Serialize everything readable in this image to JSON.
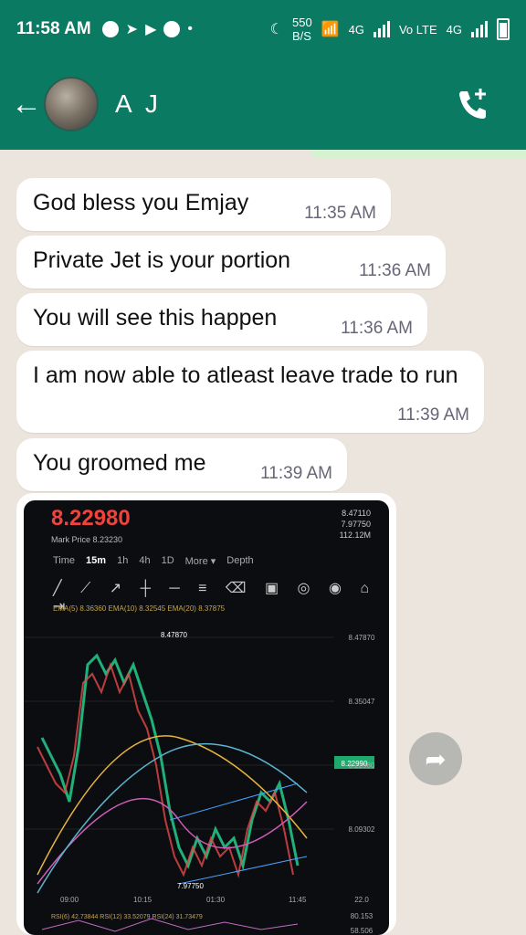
{
  "status_bar": {
    "time": "11:58 AM",
    "net_speed": "550",
    "net_unit": "B/S",
    "sim1": "4G",
    "sim2_label": "Vo LTE",
    "sim2": "4G",
    "icons": [
      "six-icon",
      "telegram-icon",
      "youtube-icon",
      "chat-icon",
      "dot-icon",
      "moon-icon",
      "wifi-icon",
      "signal-icon",
      "battery-icon"
    ]
  },
  "header": {
    "contact_name": "A J",
    "back_icon": "arrow-left-icon",
    "call_icon": "add-call-icon"
  },
  "messages": [
    {
      "text": "God bless you Emjay",
      "time": "11:35 AM"
    },
    {
      "text": "Private Jet is your portion",
      "time": "11:36 AM"
    },
    {
      "text": "You will see this happen",
      "time": "11:36 AM"
    },
    {
      "text": "I am now able to atleast leave trade to run",
      "time": "11:39 AM"
    },
    {
      "text": "You groomed me",
      "time": "11:39 AM"
    }
  ],
  "chart_image": {
    "price": "8.22980",
    "mark_price": "Mark Price 8.23230",
    "stats": [
      "8.47110",
      "7.97750",
      "112.12M"
    ],
    "tabs": [
      "Time",
      "15m",
      "1h",
      "4h",
      "1D",
      "More ▾",
      "Depth"
    ],
    "ema_line": "EMA(5) 8.36360  EMA(10) 8.32545  EMA(20) 8.37875",
    "high_label": "8.47870",
    "low_label": "7.97750",
    "x_labels": [
      "09:00",
      "10:15",
      "01:30",
      "11:45"
    ],
    "y_labels": [
      "8.47870",
      "8.35047",
      "8.22980",
      "8.09302"
    ],
    "current_price_tag": "8.22990",
    "volume_line": "RSI(6) 42.73844  RSI(12) 33.52079  RSI(24) 31.73479",
    "bottom_values": [
      "22.0",
      "80.153",
      "58.506"
    ]
  },
  "forward_icon": "share-arrow-icon"
}
